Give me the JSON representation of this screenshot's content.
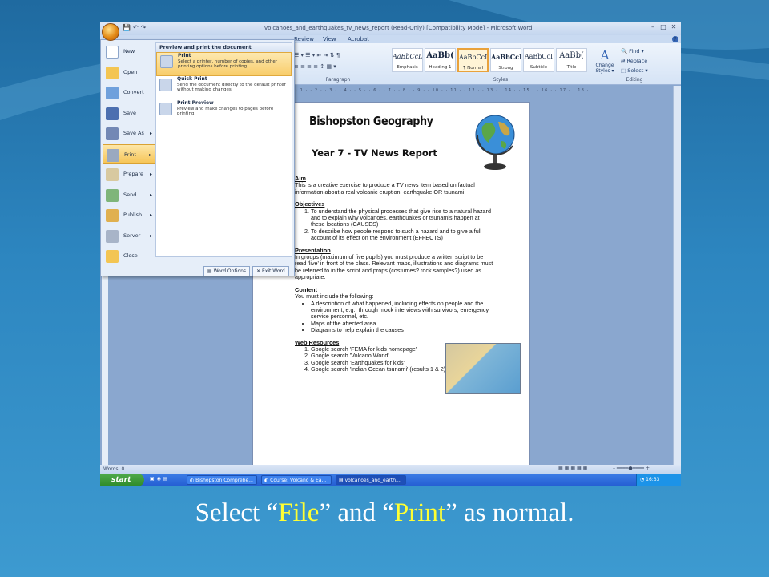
{
  "window": {
    "title": "volcanoes_and_earthquakes_tv_news_report (Read-Only) [Compatibility Mode] - Microsoft Word"
  },
  "tabs": [
    "Review",
    "View",
    "Acrobat"
  ],
  "ribbon": {
    "styles": [
      {
        "preview": "AaBbCcL",
        "name": "Emphasis"
      },
      {
        "preview": "AaBb(",
        "name": "Heading 1"
      },
      {
        "preview": "AaBbCcI",
        "name": "¶ Normal"
      },
      {
        "preview": "AaBbCcI",
        "name": "Strong"
      },
      {
        "preview": "AaBbCcI",
        "name": "Subtitle"
      },
      {
        "preview": "AaBb(",
        "name": "Title"
      }
    ],
    "change_styles": "Change Styles ▾",
    "groups": {
      "paragraph": "Paragraph",
      "styles": "Styles",
      "editing": "Editing"
    },
    "editing": [
      "Find ▾",
      "Replace",
      "Select ▾"
    ]
  },
  "ruler": "· 1 · · 2 · · 3 · · 4 · · 5 · · 6 · · 7 · · 8 · · 9 · · 10 · · 11 · · 12 · · 13 · · 14 · · 15 · · 16 · · 17 · · 18 ·",
  "office_menu": {
    "items": [
      {
        "label": "New",
        "arrow": false
      },
      {
        "label": "Open",
        "arrow": false
      },
      {
        "label": "Convert",
        "arrow": false
      },
      {
        "label": "Save",
        "arrow": false
      },
      {
        "label": "Save As",
        "arrow": true
      },
      {
        "label": "Print",
        "arrow": true
      },
      {
        "label": "Prepare",
        "arrow": true
      },
      {
        "label": "Send",
        "arrow": true
      },
      {
        "label": "Publish",
        "arrow": true
      },
      {
        "label": "Server",
        "arrow": true
      },
      {
        "label": "Close",
        "arrow": false
      }
    ],
    "highlighted": "Print",
    "pane_title": "Preview and print the document",
    "options": [
      {
        "title": "Print",
        "desc": "Select a printer, number of copies, and other printing options before printing."
      },
      {
        "title": "Quick Print",
        "desc": "Send the document directly to the default printer without making changes."
      },
      {
        "title": "Print Preview",
        "desc": "Preview and make changes to pages before printing."
      }
    ],
    "word_options": "Word Options",
    "exit_word": "Exit Word"
  },
  "document": {
    "title1": "Bishopston Geography",
    "title2": "Year 7 - TV News Report",
    "aim_h": "Aim",
    "aim": "This is a creative exercise to produce a TV news item based on factual information about a real volcanic eruption, earthquake OR tsunami.",
    "obj_h": "Objectives",
    "objectives": [
      "To understand the physical processes that give rise to a natural hazard and to explain why volcanoes, earthquakes or tsunamis happen at these locations (CAUSES)",
      "To describe how people respond to such a hazard and to give a full account of its effect on the environment (EFFECTS)"
    ],
    "pres_h": "Presentation",
    "presentation": "In groups (maximum of five pupils) you must produce a written script to be read 'live' in front of the class.  Relevant maps, illustrations and diagrams must be referred to in the script and props (costumes? rock samples?) used as appropriate.",
    "content_h": "Content",
    "content_intro": "You must include the following:",
    "content": [
      "A description of what happened, including effects on people and the environment, e.g., through mock interviews with survivors, emergency service personnel, etc.",
      "Maps of the affected area",
      "Diagrams to help explain the causes"
    ],
    "web_h": "Web Resources",
    "web": [
      "Google search 'FEMA for kids homepage'",
      "Google search 'Volcano World'",
      "Google search 'Earthquakes for kids'",
      "Google search 'Indian Ocean tsunami' (results 1 & 2)"
    ]
  },
  "statusbar": {
    "words": "Words: 0"
  },
  "taskbar": {
    "start": "start",
    "items": [
      "Bishopston Comprehe...",
      "Course: Volcano & Ea...",
      "volcanoes_and_earth..."
    ],
    "lang": "EN",
    "clock": "16:33"
  },
  "caption": {
    "a": "Select  “",
    "b": "File",
    "c": "” and “",
    "d": "Print",
    "e": "” as normal."
  }
}
